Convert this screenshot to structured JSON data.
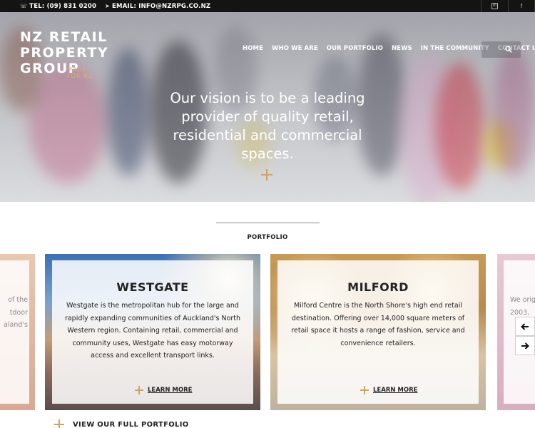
{
  "topbar": {
    "phone": "TEL: (09) 831 0200",
    "email": "EMAIL: INFO@NZRPG.CO.NZ",
    "social": [
      {
        "icon": "linkedin-icon",
        "glyph": "in"
      },
      {
        "icon": "facebook-icon",
        "glyph": "f"
      }
    ]
  },
  "logo": {
    "line1": "NZ RETAIL",
    "line2": "PROPERTY",
    "line3": "GROUP",
    "tagline": "MADE FOR NZ"
  },
  "nav": {
    "items": [
      "HOME",
      "WHO WE ARE",
      "OUR PORTFOLIO",
      "NEWS",
      "IN THE COMMUNITY",
      "CONTACT US"
    ]
  },
  "hero": {
    "vision": "Our vision is to be a leading provider of quality retail, residential and commercial spaces."
  },
  "portfolio": {
    "title": "PORTFOLIO",
    "left_partial_lines": [
      "of the",
      "tdoor",
      "aland's"
    ],
    "right_partial_lines": [
      "We orig",
      "2003,"
    ],
    "cards": [
      {
        "name": "WESTGATE",
        "description": "Westgate is the metropolitan hub for the large and rapidly expanding communities of Auckland's North Western region. Containing retail, commercial and community uses, Westgate has easy motorway access and excellent transport links.",
        "cta": "LEARN MORE"
      },
      {
        "name": "MILFORD",
        "description": "Milford Centre is the North Shore's high end retail destination. Offering over 14,000 square meters of retail space it hosts a range of fashion, service and convenience retailers.",
        "cta": "LEARN MORE"
      }
    ],
    "view_all": "VIEW OUR FULL PORTFOLIO"
  },
  "colors": {
    "accent_gold": "#c9a46a",
    "topbar_bg": "#141414"
  }
}
